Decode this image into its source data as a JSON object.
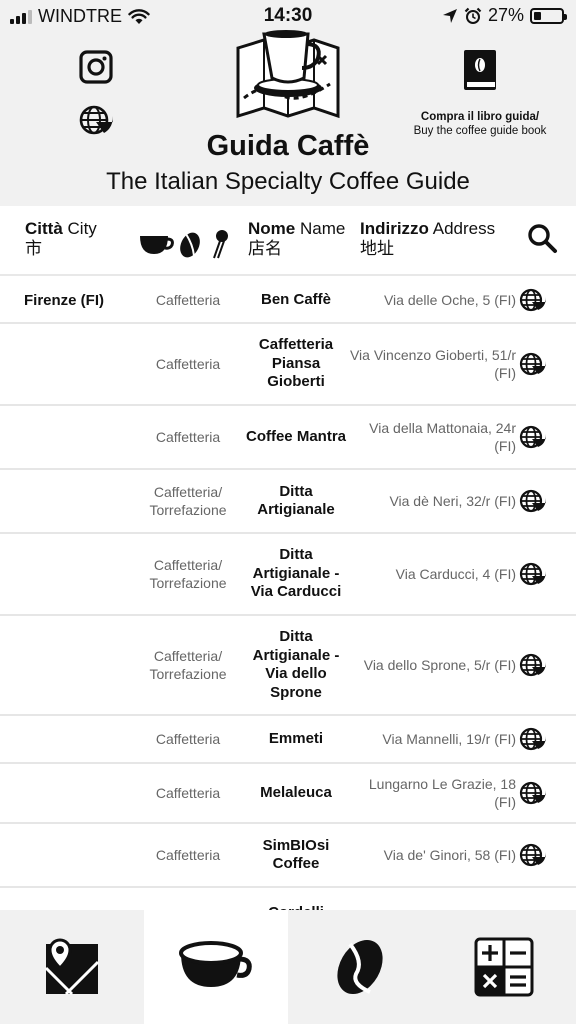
{
  "status_bar": {
    "carrier": "WINDTRE",
    "time": "14:30",
    "battery_label": "27%",
    "battery_level": 0.27
  },
  "header": {
    "title": "Guida Caffè",
    "subtitle": "The Italian Specialty Coffee Guide",
    "buy_line1": "Compra il libro guida/",
    "buy_line2": "Buy the coffee guide book"
  },
  "columns": {
    "city_it": "Città",
    "city_en": "City",
    "city_zh": "市",
    "name_it": "Nome",
    "name_en": "Name",
    "name_zh": "店名",
    "address_it": "Indirizzo",
    "address_en": "Address",
    "address_zh": "地址"
  },
  "rows": [
    {
      "city": "Firenze (FI)",
      "type": "Caffetteria",
      "name": "Ben Caffè",
      "address": "Via delle Oche, 5 (FI)"
    },
    {
      "city": "",
      "type": "Caffetteria",
      "name": "Caffetteria Piansa Gioberti",
      "address": "Via Vincenzo Gioberti, 51/r (FI)"
    },
    {
      "city": "",
      "type": "Caffetteria",
      "name": "Coffee Mantra",
      "address": "Via della Mattonaia, 24r (FI)"
    },
    {
      "city": "",
      "type": "Caffetteria/ Torrefazione",
      "name": "Ditta Artigianale",
      "address": "Via dè Neri, 32/r (FI)"
    },
    {
      "city": "",
      "type": "Caffetteria/ Torrefazione",
      "name": "Ditta Artigianale - Via Carducci",
      "address": "Via Carducci, 4 (FI)"
    },
    {
      "city": "",
      "type": "Caffetteria/ Torrefazione",
      "name": "Ditta Artigianale - Via dello Sprone",
      "address": "Via dello Sprone, 5/r (FI)"
    },
    {
      "city": "",
      "type": "Caffetteria",
      "name": "Emmeti",
      "address": "Via Mannelli, 19/r (FI)"
    },
    {
      "city": "",
      "type": "Caffetteria",
      "name": "Melaleuca",
      "address": "Lungarno Le Grazie, 18 (FI)"
    },
    {
      "city": "",
      "type": "Caffetteria",
      "name": "SimBIOsi Coffee",
      "address": "Via de' Ginori, 58 (FI)"
    },
    {
      "city": "",
      "type": "",
      "name": "Cordelli",
      "address": ""
    }
  ],
  "tabs": [
    {
      "name": "map-tab",
      "icon": "map-icon",
      "active": false
    },
    {
      "name": "cafes-tab",
      "icon": "coffee-cup-icon",
      "active": true
    },
    {
      "name": "beans-tab",
      "icon": "coffee-bean-icon",
      "active": false
    },
    {
      "name": "calculator-tab",
      "icon": "calculator-icon",
      "active": false
    }
  ],
  "colors": {
    "header_bg": "#f1f1f1",
    "divider": "#e6e6e6",
    "secondary_text": "#666666"
  }
}
